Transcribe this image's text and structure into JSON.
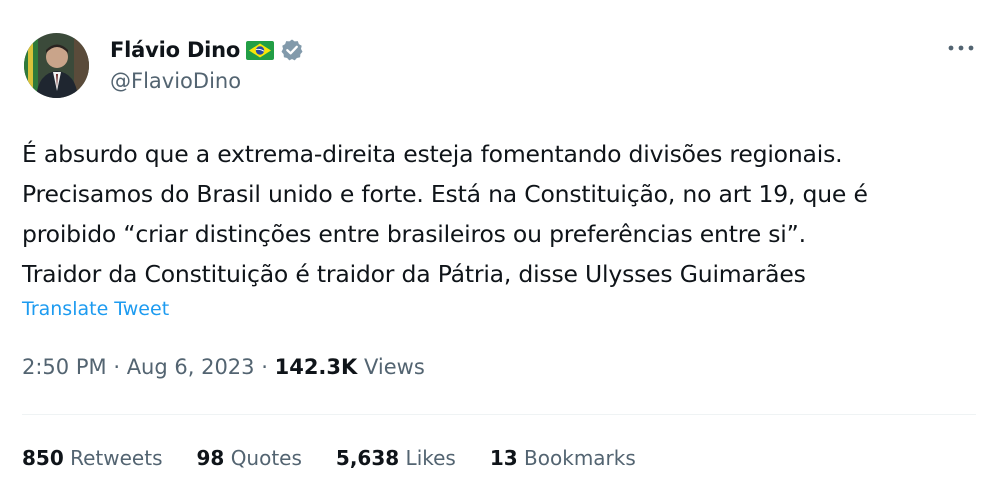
{
  "author": {
    "display_name": "Flávio Dino",
    "handle": "@FlavioDino",
    "flag_icon": "brazil-flag-icon",
    "verified_icon": "verified-badge-icon",
    "verified_color": "#829aab"
  },
  "tweet": {
    "text_lines": [
      "É absurdo que a extrema-direita esteja fomentando divisões regionais.",
      "Precisamos do Brasil unido e forte. Está na Constituição, no art 19, que é",
      "proibido “criar distinções entre brasileiros ou preferências entre si”.",
      "Traidor da Constituição é traidor da Pátria, disse Ulysses Guimarães"
    ],
    "translate_label": "Translate Tweet",
    "time": "2:50 PM",
    "separator": "·",
    "date": "Aug 6, 2023",
    "views_count": "142.3K",
    "views_label": "Views"
  },
  "stats": [
    {
      "count": "850",
      "label": "Retweets"
    },
    {
      "count": "98",
      "label": "Quotes"
    },
    {
      "count": "5,638",
      "label": "Likes"
    },
    {
      "count": "13",
      "label": "Bookmarks"
    }
  ],
  "more_icon": "more-options-icon",
  "colors": {
    "link": "#1d9bf0",
    "secondary_text": "#536471",
    "primary_text": "#0f1419"
  }
}
